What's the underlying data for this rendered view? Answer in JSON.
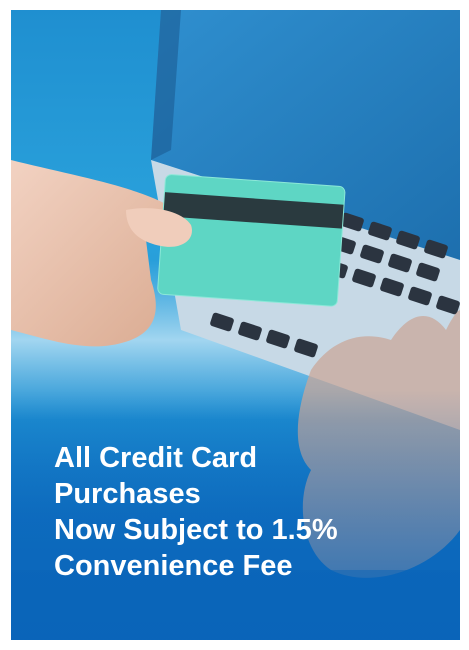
{
  "headline": {
    "lines": [
      "All Credit Card",
      "Purchases",
      "Now Subject to 1.5%",
      "Convenience Fee"
    ]
  },
  "colors": {
    "background": "#1e8fd2",
    "card": "#5ed6c4",
    "text": "#ffffff"
  },
  "icons": {
    "illustration": "credit-card-laptop-illustration"
  }
}
